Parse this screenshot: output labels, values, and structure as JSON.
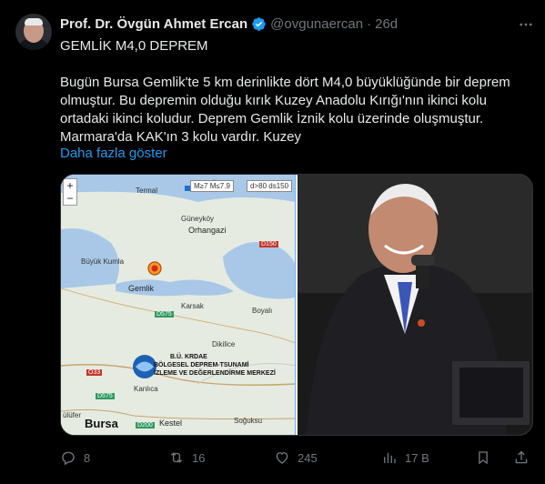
{
  "author": {
    "name": "Prof. Dr. Övgün Ahmet Ercan",
    "handle": "@ovgunaercan",
    "separator": "·",
    "time": "26d"
  },
  "tweet": {
    "title": "GEMLİK M4,0 DEPREM",
    "lines": [
      "Bugün Bursa Gemlik'te 5 km derinlikte dört M4,0 büyüklüğünde bir deprem",
      "olmuştur. Bu depremin olduğu kırık Kuzey Anadolu Kırığı'nın ikinci kolu",
      "ortadaki ikinci koludur. Deprem Gemlik İznik kolu üzerinde oluşmuştur.",
      "Marmara'da KAK'ın 3 kolu vardır. Kuzey"
    ],
    "show_more": "Daha fazla göster"
  },
  "map": {
    "zoom_in": "+",
    "zoom_out": "−",
    "legend_a": "M≥7  M≤7.9",
    "legend_b": "d>80 ds150",
    "labels": {
      "termal": "Termal",
      "guneykoy": "Güneyköy",
      "orhangazi": "Orhangazi",
      "d150": "D150",
      "buyuk_kumla": "Büyük Kumla",
      "gemlik": "Gemlik",
      "karsak": "Karsak",
      "d575_top": "D575",
      "boyali": "Boyalı",
      "dikilice": "Dikilice",
      "o33": "O33",
      "d575": "D575",
      "kanlica": "Kanlıca",
      "ulufer": "ülüfer",
      "bursa": "Bursa",
      "d200": "D200",
      "kestel": "Kestel",
      "sogukus": "Soğuksu"
    },
    "institute": [
      "B.Ü. KRDAE",
      "BÖLGESEL DEPREM-TSUNAMİ",
      "İZLEME VE DEĞERLENDİRME MERKEZİ"
    ]
  },
  "actions": {
    "replies": "8",
    "reposts": "16",
    "likes": "245",
    "views": "17 B"
  },
  "colors": {
    "accent": "#1d9bf0",
    "muted": "#71767b",
    "background": "#000000"
  },
  "icons": [
    "verified-badge-icon",
    "more-icon",
    "reply-icon",
    "repost-icon",
    "like-icon",
    "views-icon",
    "bookmark-icon",
    "share-icon"
  ]
}
